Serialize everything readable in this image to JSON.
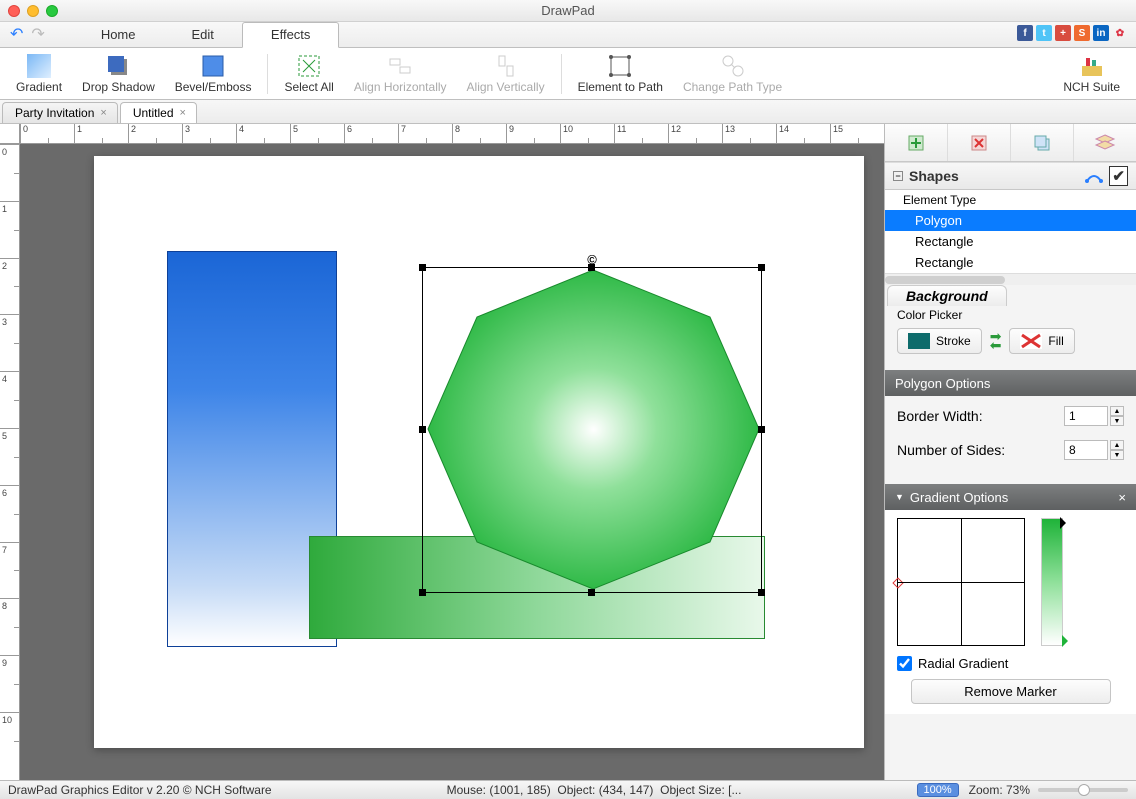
{
  "app_title": "DrawPad",
  "menu_tabs": [
    "Home",
    "Edit",
    "Effects"
  ],
  "menu_active": 2,
  "ribbon": {
    "gradient": "Gradient",
    "drop_shadow": "Drop Shadow",
    "bevel": "Bevel/Emboss",
    "select_all": "Select All",
    "align_h": "Align Horizontally",
    "align_v": "Align Vertically",
    "el_to_path": "Element to Path",
    "change_path": "Change Path Type",
    "nch_suite": "NCH Suite"
  },
  "doc_tabs": [
    "Party Invitation",
    "Untitled"
  ],
  "doc_active": 1,
  "ruler_h": [
    "0",
    "1",
    "2",
    "3",
    "4",
    "5",
    "6",
    "7",
    "8",
    "9",
    "10",
    "11",
    "12",
    "13",
    "14",
    "15"
  ],
  "ruler_v": [
    "0",
    "1",
    "2",
    "3",
    "4",
    "5",
    "6",
    "7",
    "8",
    "9",
    "10"
  ],
  "shapes_panel": {
    "title": "Shapes",
    "header": "Element Type",
    "items": [
      "Polygon",
      "Rectangle",
      "Rectangle"
    ],
    "selected": 0
  },
  "background": {
    "tab": "Background",
    "color_picker": "Color Picker",
    "stroke_label": "Stroke",
    "fill_label": "Fill",
    "stroke_color": "#0d6b6b"
  },
  "polygon_options": {
    "title": "Polygon Options",
    "border_width_label": "Border Width:",
    "border_width_value": "1",
    "sides_label": "Number of Sides:",
    "sides_value": "8"
  },
  "gradient_options": {
    "title": "Gradient Options",
    "radial_label": "Radial Gradient",
    "radial_checked": true,
    "remove_marker": "Remove Marker"
  },
  "status": {
    "version": "DrawPad Graphics Editor v 2.20 © NCH Software",
    "mouse": "Mouse: (1001, 185)",
    "object": "Object: (434, 147)",
    "object_size": "Object Size: [...",
    "zoom_select": "100%",
    "zoom_label": "Zoom: 73%"
  }
}
